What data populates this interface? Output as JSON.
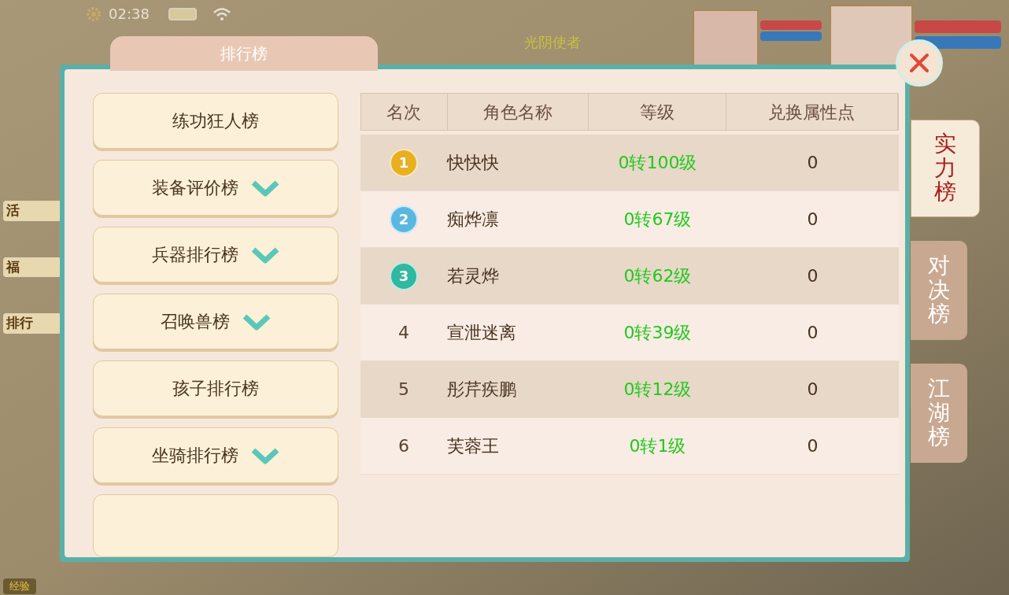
{
  "status_bar": {
    "time": "02:38"
  },
  "scene": {
    "npc_name": "光阴使者",
    "side_buttons": [
      "活",
      "福",
      "排行"
    ],
    "exp_label": "经验"
  },
  "panel": {
    "title": "排行榜"
  },
  "categories": [
    {
      "label": "练功狂人榜",
      "expandable": false
    },
    {
      "label": "装备评价榜",
      "expandable": true
    },
    {
      "label": "兵器排行榜",
      "expandable": true
    },
    {
      "label": "召唤兽榜",
      "expandable": true
    },
    {
      "label": "孩子排行榜",
      "expandable": false
    },
    {
      "label": "坐骑排行榜",
      "expandable": true
    }
  ],
  "table": {
    "columns": [
      "名次",
      "角色名称",
      "等级",
      "兑换属性点"
    ],
    "rows": [
      {
        "rank": "1",
        "kind": "medal",
        "color": "#e8b020",
        "name": "快快快",
        "level": "0转100级",
        "points": "0"
      },
      {
        "rank": "2",
        "kind": "medal",
        "color": "#5ab8e0",
        "name": "痴烨凛",
        "level": "0转67级",
        "points": "0"
      },
      {
        "rank": "3",
        "kind": "medal",
        "color": "#30b8a0",
        "name": "若灵烨",
        "level": "0转62级",
        "points": "0"
      },
      {
        "rank": "4",
        "kind": "plain",
        "name": "宣泄迷离",
        "level": "0转39级",
        "points": "0"
      },
      {
        "rank": "5",
        "kind": "plain",
        "name": "彤芹疾鹏",
        "level": "0转12级",
        "points": "0"
      },
      {
        "rank": "6",
        "kind": "plain",
        "name": "芙蓉王",
        "level": "0转1级",
        "points": "0"
      }
    ]
  },
  "side_tabs": [
    {
      "label": "实力榜",
      "selected": true
    },
    {
      "label": "对决榜",
      "selected": false
    },
    {
      "label": "江湖榜",
      "selected": false
    }
  ]
}
